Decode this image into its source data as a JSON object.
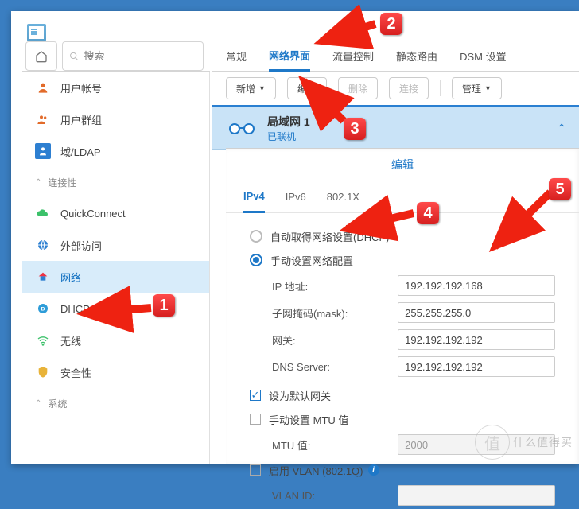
{
  "search": {
    "placeholder": "搜索"
  },
  "sidebar": {
    "items": [
      {
        "label": "用户帐号"
      },
      {
        "label": "用户群组"
      },
      {
        "label": "域/LDAP"
      }
    ],
    "section1": "连接性",
    "conn": [
      {
        "label": "QuickConnect"
      },
      {
        "label": "外部访问"
      },
      {
        "label": "网络"
      },
      {
        "label": "DHCP Server"
      },
      {
        "label": "无线"
      },
      {
        "label": "安全性"
      }
    ],
    "section2": "系统"
  },
  "tabs1": [
    "常规",
    "网络界面",
    "流量控制",
    "静态路由",
    "DSM 设置"
  ],
  "toolbar": {
    "add": "新增",
    "edit": "编辑",
    "del": "删除",
    "conn": "连接",
    "mgr": "管理"
  },
  "iface": {
    "name": "局域网 1",
    "status": "已联机"
  },
  "dialog": {
    "title": "编辑",
    "tabs": [
      "IPv4",
      "IPv6",
      "802.1X"
    ],
    "radio_dhcp": "自动取得网络设置(DHCP)",
    "radio_manual": "手动设置网络配置",
    "ip_label": "IP 地址:",
    "ip_value": "192.192.192.168",
    "mask_label": "子网掩码(mask):",
    "mask_value": "255.255.255.0",
    "gw_label": "网关:",
    "gw_value": "192.192.192.192",
    "dns_label": "DNS Server:",
    "dns_value": "192.192.192.192",
    "default_gw": "设为默认网关",
    "manual_mtu": "手动设置 MTU 值",
    "mtu_label": "MTU 值:",
    "mtu_value": "2000",
    "vlan_enable": "启用 VLAN (802.1Q)",
    "vlan_id_label": "VLAN ID:"
  },
  "watermark": "什么值得买",
  "annotations": {
    "1": "1",
    "2": "2",
    "3": "3",
    "4": "4",
    "5": "5"
  }
}
